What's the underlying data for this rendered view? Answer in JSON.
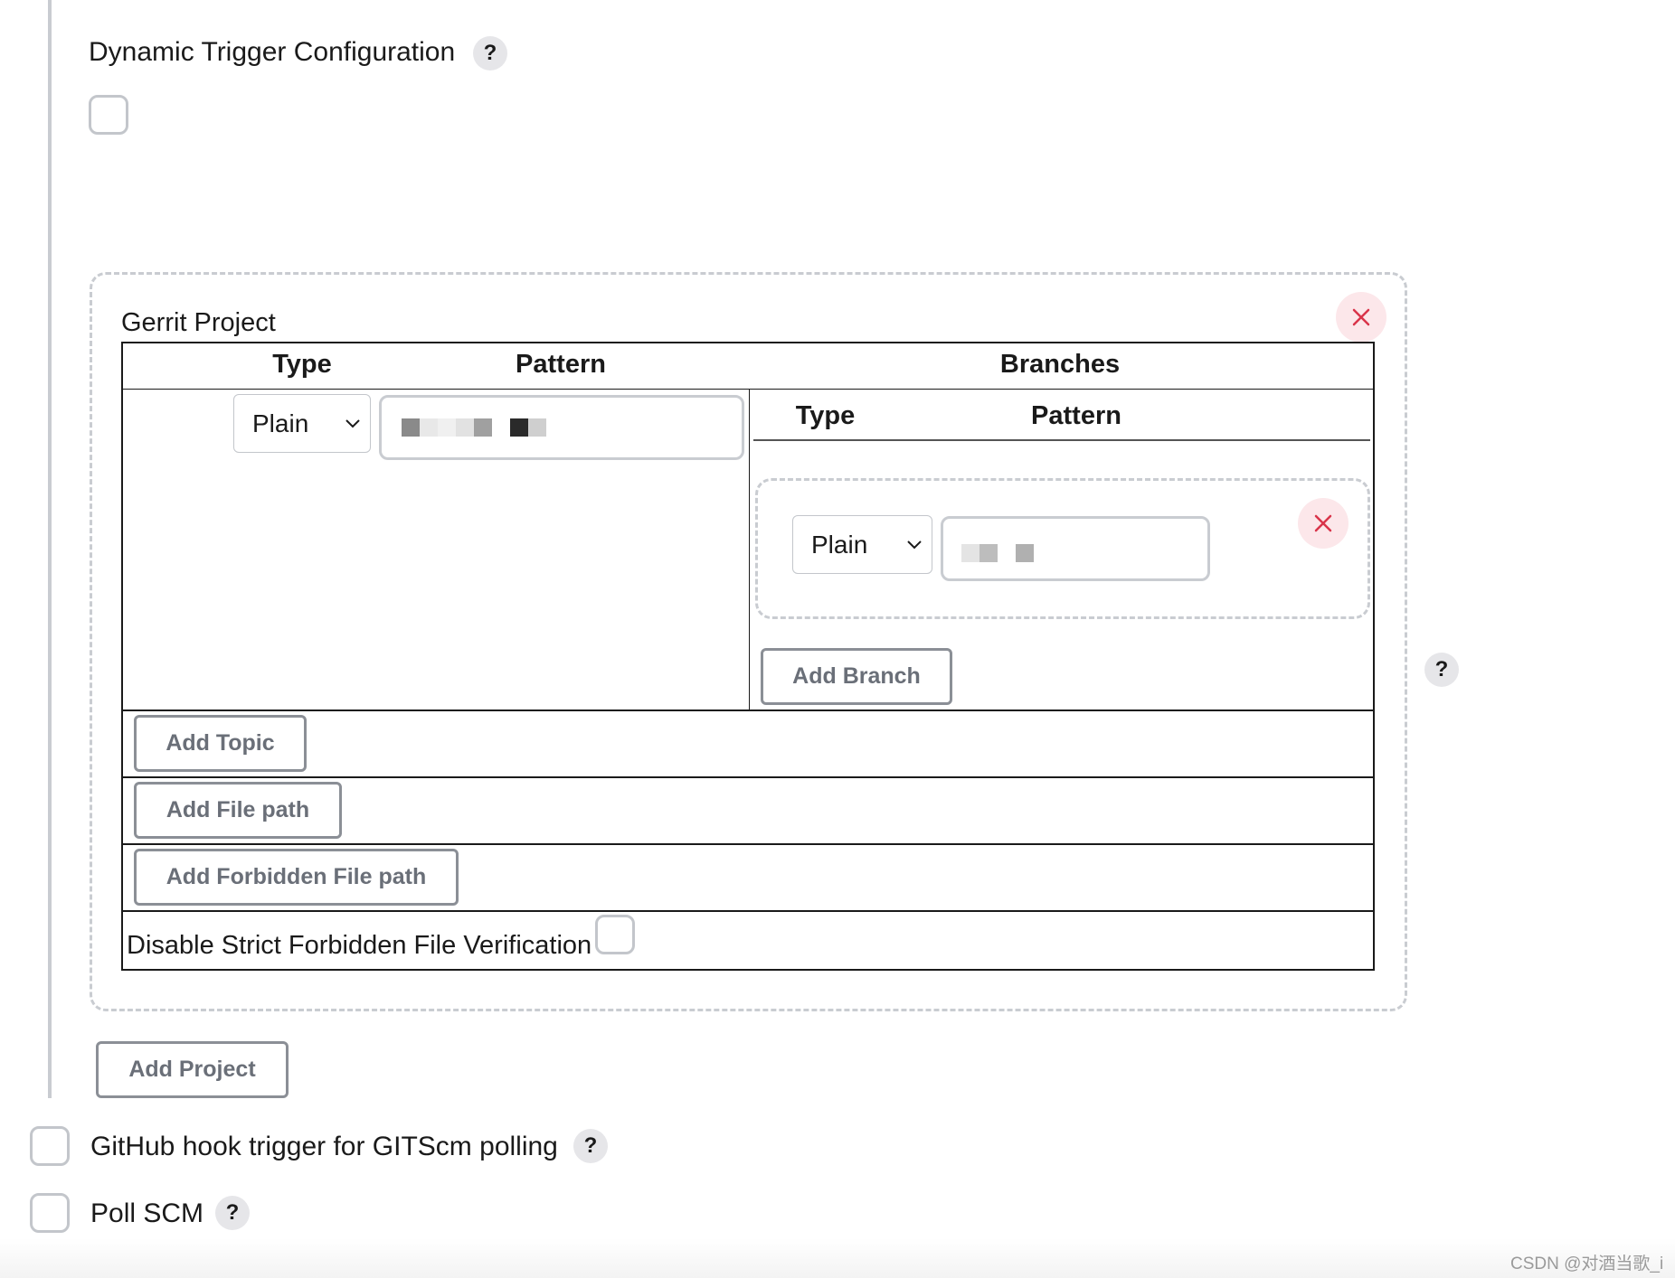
{
  "dynamic_trigger": {
    "title": "Dynamic Trigger Configuration",
    "help": "?"
  },
  "gerrit_project": {
    "title": "Gerrit Project",
    "headers": {
      "type": "Type",
      "pattern": "Pattern",
      "branches": "Branches"
    },
    "project_type": "Plain",
    "branches": {
      "headers": {
        "type": "Type",
        "pattern": "Pattern"
      },
      "branch_type": "Plain",
      "add_branch": "Add Branch"
    },
    "add_topic": "Add Topic",
    "add_file_path": "Add File path",
    "add_forbidden_file_path": "Add Forbidden File path",
    "disable_strict_label": "Disable Strict Forbidden File Verification",
    "help": "?"
  },
  "add_project": "Add Project",
  "github_hook": {
    "label": "GitHub hook trigger for GITScm polling",
    "help": "?"
  },
  "poll_scm": {
    "label": "Poll SCM",
    "help": "?"
  },
  "watermark": "CSDN @对酒当歌_i",
  "colors": {
    "close_x": "#d9344a",
    "close_bg": "#fce7ea",
    "border": "#c9ccd1",
    "button_text": "#6a6f78"
  },
  "icons": [
    "help-icon",
    "close-icon",
    "chevron-down-icon"
  ]
}
